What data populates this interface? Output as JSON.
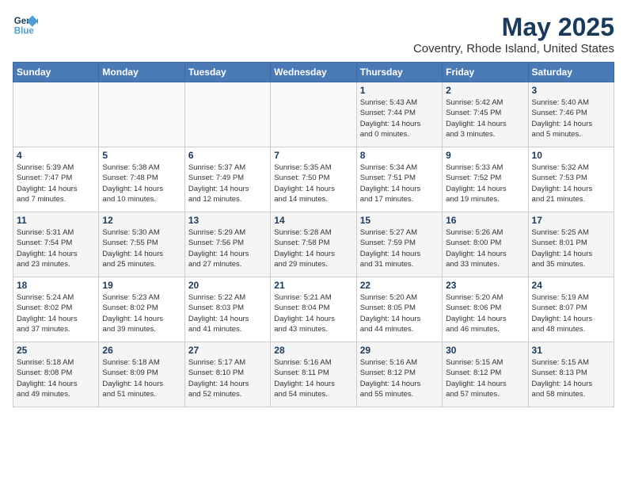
{
  "header": {
    "logo_line1": "General",
    "logo_line2": "Blue",
    "month": "May 2025",
    "location": "Coventry, Rhode Island, United States"
  },
  "weekdays": [
    "Sunday",
    "Monday",
    "Tuesday",
    "Wednesday",
    "Thursday",
    "Friday",
    "Saturday"
  ],
  "weeks": [
    [
      {
        "day": "",
        "content": ""
      },
      {
        "day": "",
        "content": ""
      },
      {
        "day": "",
        "content": ""
      },
      {
        "day": "",
        "content": ""
      },
      {
        "day": "1",
        "content": "Sunrise: 5:43 AM\nSunset: 7:44 PM\nDaylight: 14 hours\nand 0 minutes."
      },
      {
        "day": "2",
        "content": "Sunrise: 5:42 AM\nSunset: 7:45 PM\nDaylight: 14 hours\nand 3 minutes."
      },
      {
        "day": "3",
        "content": "Sunrise: 5:40 AM\nSunset: 7:46 PM\nDaylight: 14 hours\nand 5 minutes."
      }
    ],
    [
      {
        "day": "4",
        "content": "Sunrise: 5:39 AM\nSunset: 7:47 PM\nDaylight: 14 hours\nand 7 minutes."
      },
      {
        "day": "5",
        "content": "Sunrise: 5:38 AM\nSunset: 7:48 PM\nDaylight: 14 hours\nand 10 minutes."
      },
      {
        "day": "6",
        "content": "Sunrise: 5:37 AM\nSunset: 7:49 PM\nDaylight: 14 hours\nand 12 minutes."
      },
      {
        "day": "7",
        "content": "Sunrise: 5:35 AM\nSunset: 7:50 PM\nDaylight: 14 hours\nand 14 minutes."
      },
      {
        "day": "8",
        "content": "Sunrise: 5:34 AM\nSunset: 7:51 PM\nDaylight: 14 hours\nand 17 minutes."
      },
      {
        "day": "9",
        "content": "Sunrise: 5:33 AM\nSunset: 7:52 PM\nDaylight: 14 hours\nand 19 minutes."
      },
      {
        "day": "10",
        "content": "Sunrise: 5:32 AM\nSunset: 7:53 PM\nDaylight: 14 hours\nand 21 minutes."
      }
    ],
    [
      {
        "day": "11",
        "content": "Sunrise: 5:31 AM\nSunset: 7:54 PM\nDaylight: 14 hours\nand 23 minutes."
      },
      {
        "day": "12",
        "content": "Sunrise: 5:30 AM\nSunset: 7:55 PM\nDaylight: 14 hours\nand 25 minutes."
      },
      {
        "day": "13",
        "content": "Sunrise: 5:29 AM\nSunset: 7:56 PM\nDaylight: 14 hours\nand 27 minutes."
      },
      {
        "day": "14",
        "content": "Sunrise: 5:28 AM\nSunset: 7:58 PM\nDaylight: 14 hours\nand 29 minutes."
      },
      {
        "day": "15",
        "content": "Sunrise: 5:27 AM\nSunset: 7:59 PM\nDaylight: 14 hours\nand 31 minutes."
      },
      {
        "day": "16",
        "content": "Sunrise: 5:26 AM\nSunset: 8:00 PM\nDaylight: 14 hours\nand 33 minutes."
      },
      {
        "day": "17",
        "content": "Sunrise: 5:25 AM\nSunset: 8:01 PM\nDaylight: 14 hours\nand 35 minutes."
      }
    ],
    [
      {
        "day": "18",
        "content": "Sunrise: 5:24 AM\nSunset: 8:02 PM\nDaylight: 14 hours\nand 37 minutes."
      },
      {
        "day": "19",
        "content": "Sunrise: 5:23 AM\nSunset: 8:02 PM\nDaylight: 14 hours\nand 39 minutes."
      },
      {
        "day": "20",
        "content": "Sunrise: 5:22 AM\nSunset: 8:03 PM\nDaylight: 14 hours\nand 41 minutes."
      },
      {
        "day": "21",
        "content": "Sunrise: 5:21 AM\nSunset: 8:04 PM\nDaylight: 14 hours\nand 43 minutes."
      },
      {
        "day": "22",
        "content": "Sunrise: 5:20 AM\nSunset: 8:05 PM\nDaylight: 14 hours\nand 44 minutes."
      },
      {
        "day": "23",
        "content": "Sunrise: 5:20 AM\nSunset: 8:06 PM\nDaylight: 14 hours\nand 46 minutes."
      },
      {
        "day": "24",
        "content": "Sunrise: 5:19 AM\nSunset: 8:07 PM\nDaylight: 14 hours\nand 48 minutes."
      }
    ],
    [
      {
        "day": "25",
        "content": "Sunrise: 5:18 AM\nSunset: 8:08 PM\nDaylight: 14 hours\nand 49 minutes."
      },
      {
        "day": "26",
        "content": "Sunrise: 5:18 AM\nSunset: 8:09 PM\nDaylight: 14 hours\nand 51 minutes."
      },
      {
        "day": "27",
        "content": "Sunrise: 5:17 AM\nSunset: 8:10 PM\nDaylight: 14 hours\nand 52 minutes."
      },
      {
        "day": "28",
        "content": "Sunrise: 5:16 AM\nSunset: 8:11 PM\nDaylight: 14 hours\nand 54 minutes."
      },
      {
        "day": "29",
        "content": "Sunrise: 5:16 AM\nSunset: 8:12 PM\nDaylight: 14 hours\nand 55 minutes."
      },
      {
        "day": "30",
        "content": "Sunrise: 5:15 AM\nSunset: 8:12 PM\nDaylight: 14 hours\nand 57 minutes."
      },
      {
        "day": "31",
        "content": "Sunrise: 5:15 AM\nSunset: 8:13 PM\nDaylight: 14 hours\nand 58 minutes."
      }
    ]
  ]
}
